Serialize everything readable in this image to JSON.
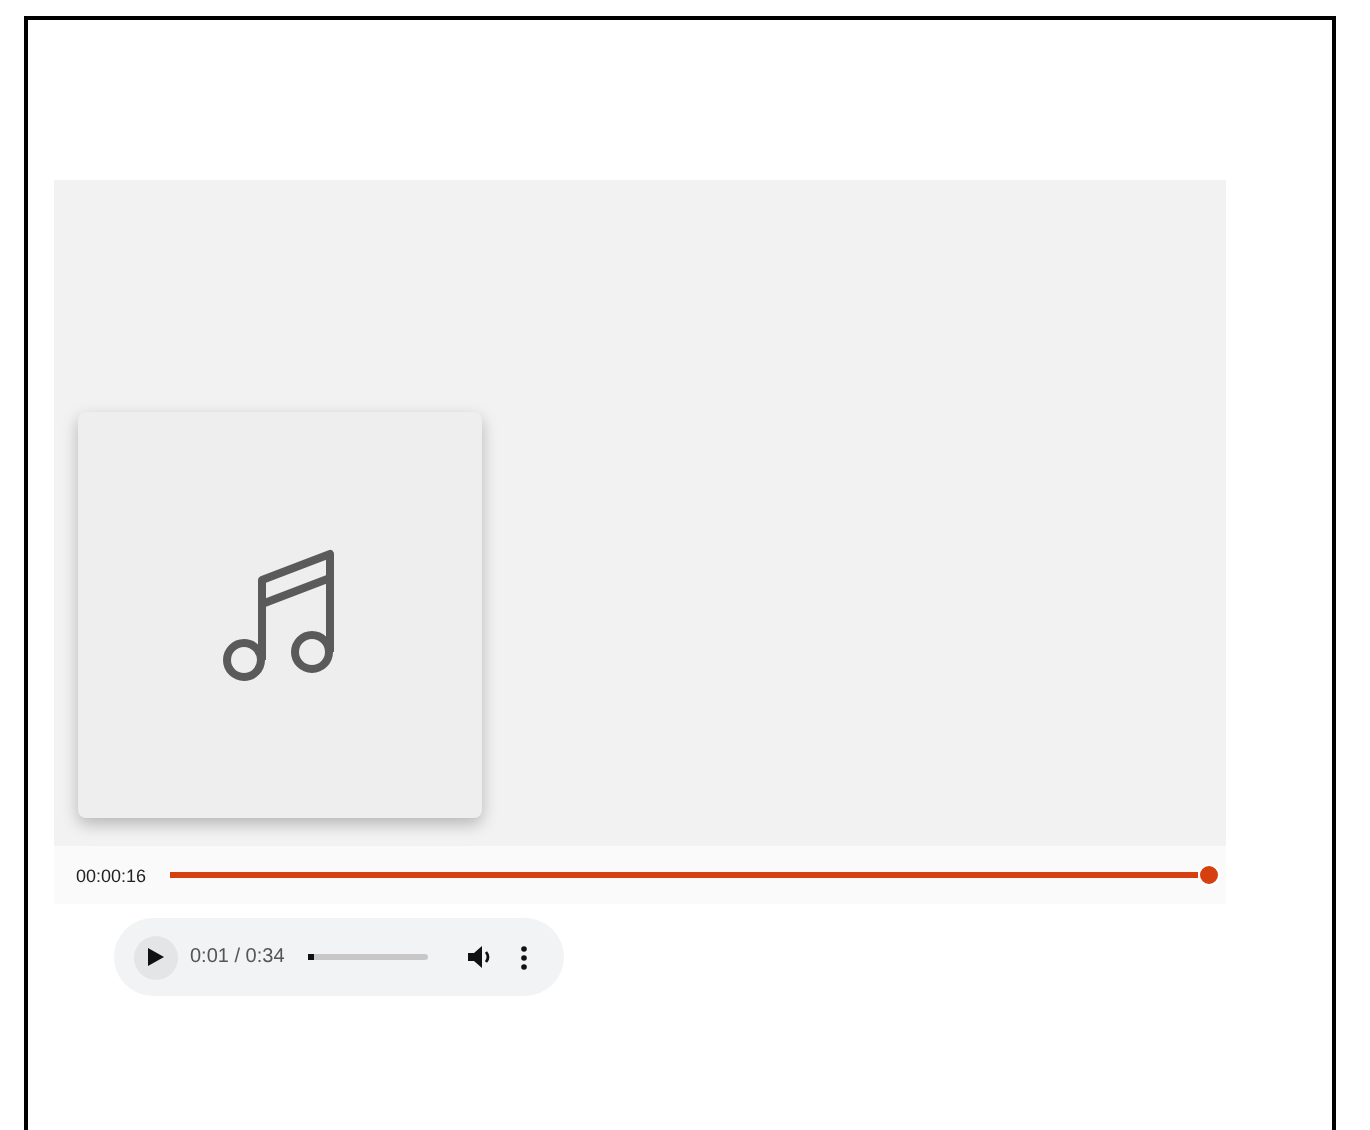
{
  "timeline": {
    "time": "00:00:16",
    "level": 0.99
  },
  "audio_player": {
    "time": "0:01 / 0:34",
    "level": 0.04
  }
}
